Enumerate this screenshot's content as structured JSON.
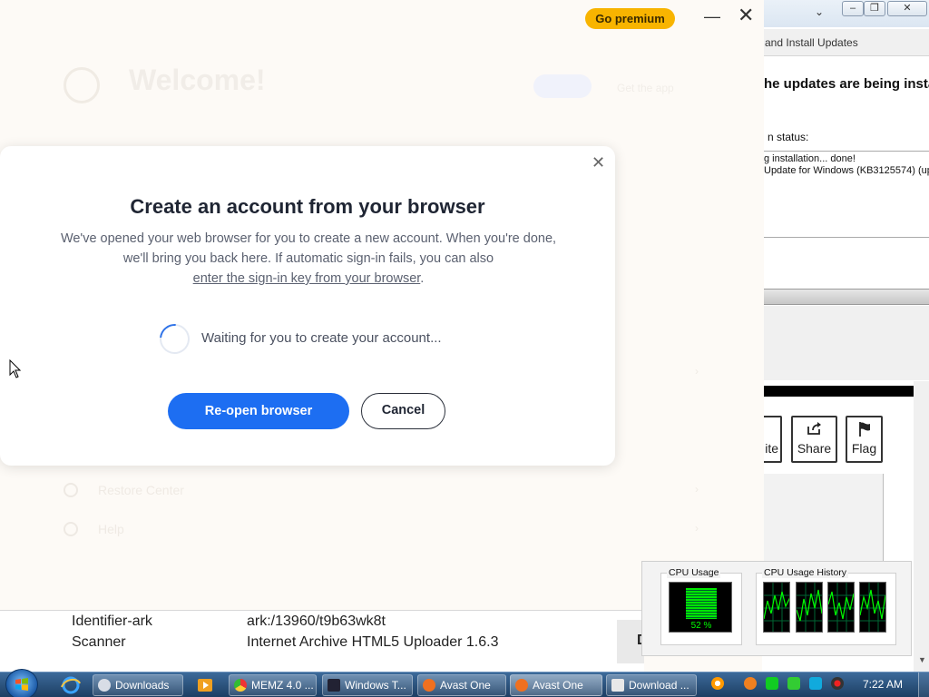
{
  "avast": {
    "premium_label": "Go premium",
    "minimize_glyph": "—",
    "close_glyph": "✕",
    "bg_title": "Welcome!",
    "bg_link": "Get the app",
    "bg_rows": [
      "",
      "",
      "",
      "",
      "Restore Center",
      "Help"
    ]
  },
  "modal": {
    "close_glyph": "✕",
    "title": "Create an account from your browser",
    "desc_part1": "We've opened your web browser for you to create a new account. When you're done, we'll bring you back here. If automatic sign-in fails, you can also",
    "desc_link": "enter the sign-in key from your browser",
    "desc_end": ".",
    "waiting": "Waiting for you to create your account...",
    "primary_button": "Re-open browser",
    "secondary_button": "Cancel",
    "accent_color": "#1d6ef2"
  },
  "update_window": {
    "subtitle": "and Install Updates",
    "heading": "he updates are being instal",
    "status_label": "n status:",
    "log_lines": [
      "g installation... done!",
      "Update for Windows (KB3125574) (up"
    ],
    "actions": [
      "ite",
      "Share",
      "Flag"
    ]
  },
  "archive": {
    "rows": [
      {
        "label": "Identifier-ark",
        "value": "ark:/13960/t9b63wk8t"
      },
      {
        "label": "Scanner",
        "value": "Internet Archive HTML5 Uploader 1.6.3"
      }
    ],
    "cut_button": "D"
  },
  "cpu_gadget": {
    "usage_title": "CPU Usage",
    "history_title": "CPU Usage History",
    "usage_percent": "52 %"
  },
  "taskbar": {
    "tasks": [
      "Downloads",
      "MEMZ 4.0 ...",
      "Windows T...",
      "Avast One",
      "Avast One",
      "Download ..."
    ],
    "clock": "7:22 AM"
  }
}
